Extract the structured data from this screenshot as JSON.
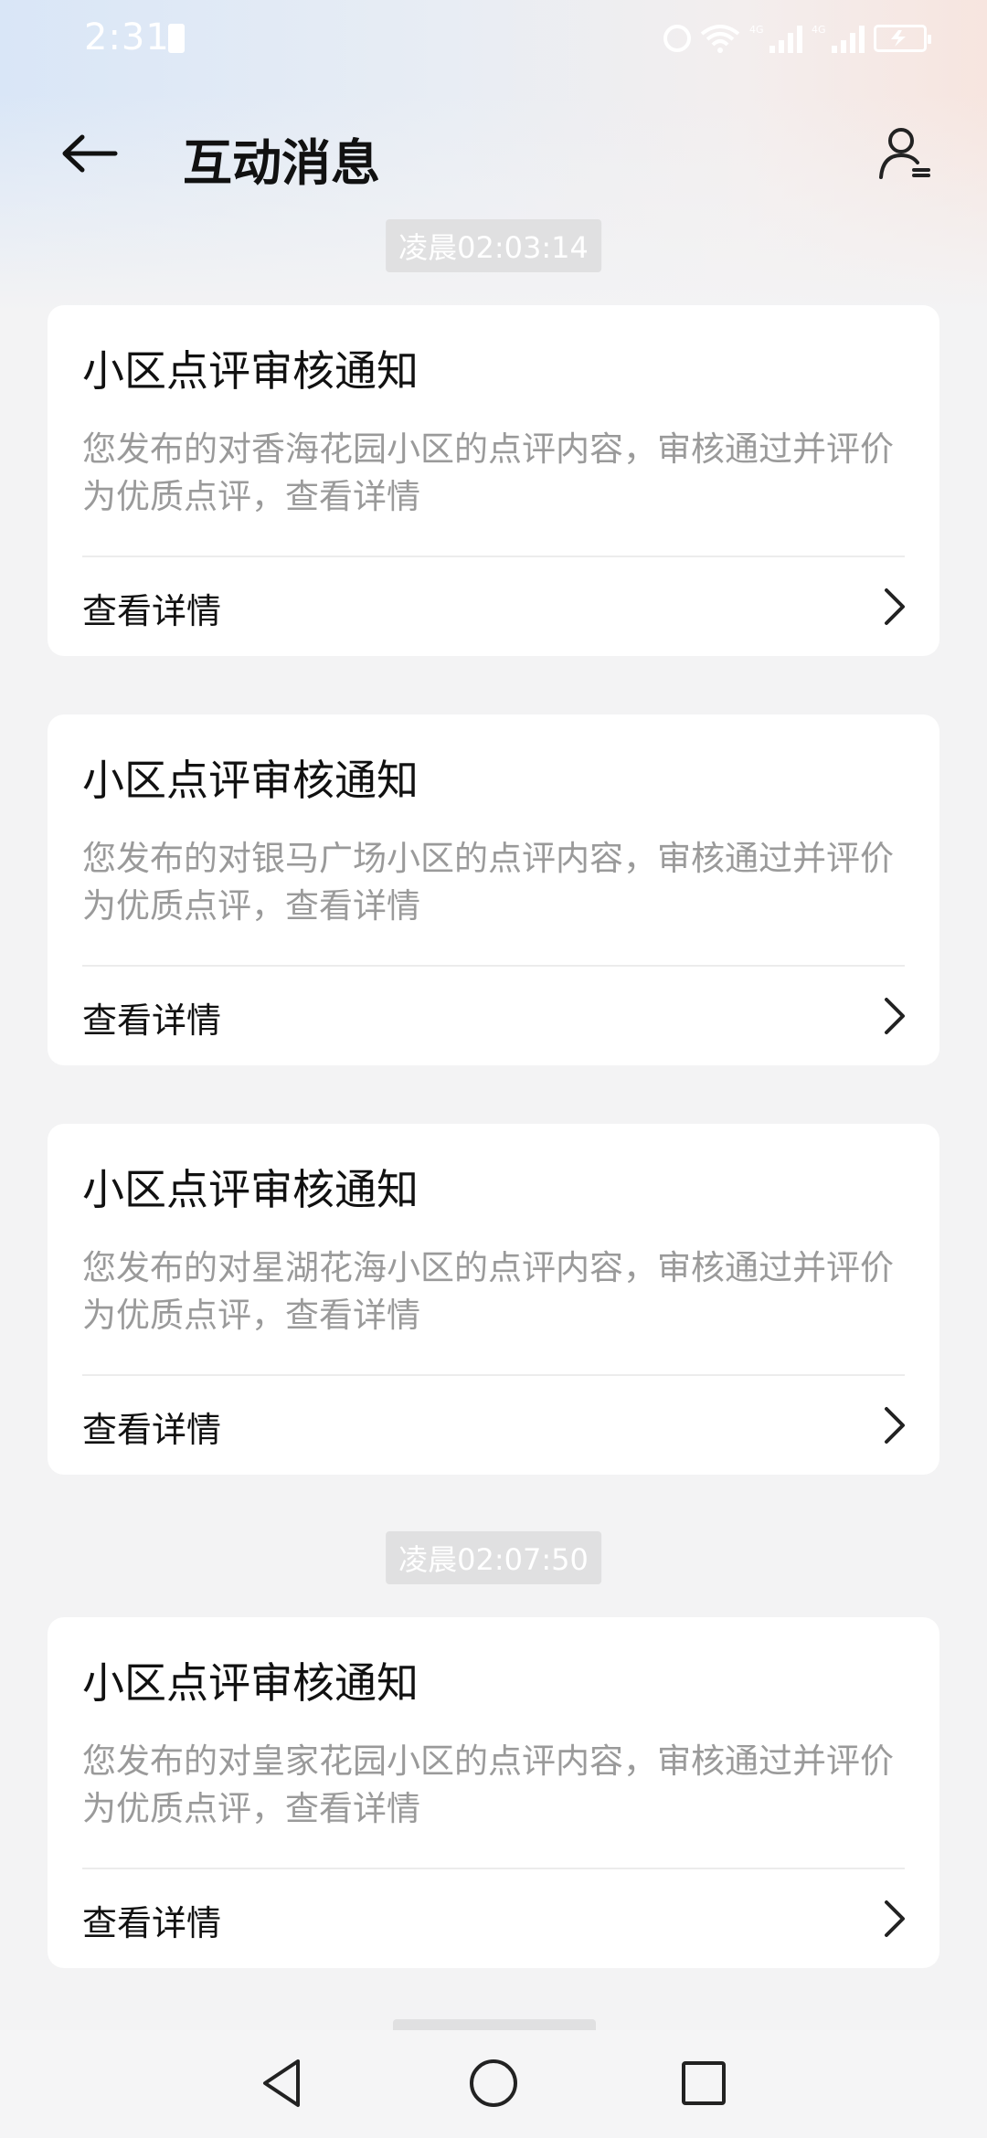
{
  "status_bar": {
    "time": "2:31",
    "network_1": "4G",
    "network_2": "4G"
  },
  "header": {
    "title": "互动消息",
    "back_icon": "back-arrow-icon",
    "profile_icon": "user-settings-icon"
  },
  "timestamps": [
    "凌晨02:03:14",
    "凌晨02:07:50"
  ],
  "cards": [
    {
      "title": "小区点评审核通知",
      "body": "您发布的对香海花园小区的点评内容，审核通过并评价为优质点评，查看详情",
      "action": "查看详情"
    },
    {
      "title": "小区点评审核通知",
      "body": "您发布的对银马广场小区的点评内容，审核通过并评价为优质点评，查看详情",
      "action": "查看详情"
    },
    {
      "title": "小区点评审核通知",
      "body": "您发布的对星湖花海小区的点评内容，审核通过并评价为优质点评，查看详情",
      "action": "查看详情"
    },
    {
      "title": "小区点评审核通知",
      "body": "您发布的对皇家花园小区的点评内容，审核通过并评价为优质点评，查看详情",
      "action": "查看详情"
    }
  ],
  "nav": {
    "back": "triangle-back-icon",
    "home": "circle-home-icon",
    "recents": "square-recents-icon"
  },
  "colors": {
    "background": "#f3f3f4",
    "card": "#ffffff",
    "title_text": "#111111",
    "body_text": "#9a9a9a",
    "timestamp_bg": "#e0e0e1"
  }
}
